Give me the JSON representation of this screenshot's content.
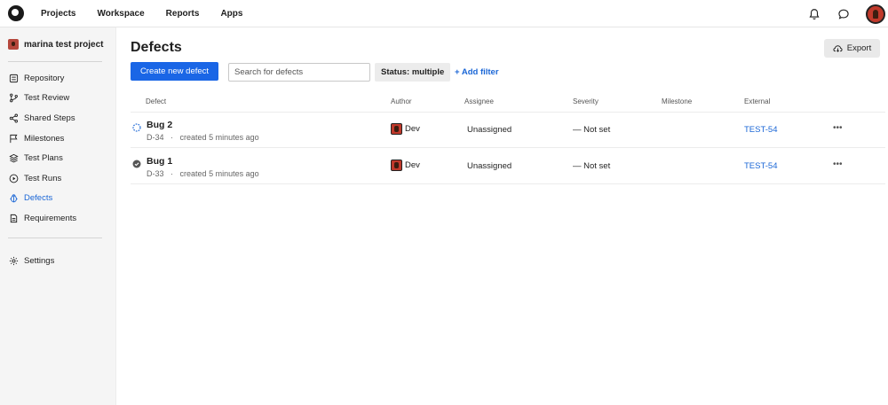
{
  "topnav": {
    "items": [
      "Projects",
      "Workspace",
      "Reports",
      "Apps"
    ]
  },
  "sidebar": {
    "project_name": "marina test project",
    "items": [
      {
        "label": "Repository",
        "icon": "list-icon"
      },
      {
        "label": "Test Review",
        "icon": "branch-icon"
      },
      {
        "label": "Shared Steps",
        "icon": "share-icon"
      },
      {
        "label": "Milestones",
        "icon": "flag-icon"
      },
      {
        "label": "Test Plans",
        "icon": "layers-icon"
      },
      {
        "label": "Test Runs",
        "icon": "play-icon"
      },
      {
        "label": "Defects",
        "icon": "bug-icon",
        "active": true
      },
      {
        "label": "Requirements",
        "icon": "document-icon"
      }
    ],
    "settings_label": "Settings"
  },
  "main": {
    "title": "Defects",
    "export_label": "Export",
    "create_label": "Create new defect",
    "search_placeholder": "Search for defects",
    "status_filter": "Status: multiple",
    "add_filter": "+ Add filter",
    "columns": [
      "Defect",
      "Author",
      "Assignee",
      "Severity",
      "Milestone",
      "External"
    ],
    "rows": [
      {
        "title": "Bug 2",
        "id": "D-34",
        "created": "created 5 minutes ago",
        "status": "in-progress",
        "author": "Dev",
        "assignee": "Unassigned",
        "severity": "— Not set",
        "milestone": "",
        "external": "TEST-54"
      },
      {
        "title": "Bug 1",
        "id": "D-33",
        "created": "created 5 minutes ago",
        "status": "resolved",
        "author": "Dev",
        "assignee": "Unassigned",
        "severity": "— Not set",
        "milestone": "",
        "external": "TEST-54"
      }
    ],
    "meta_separator": "·"
  },
  "colors": {
    "accent": "#1a66e6",
    "link": "#1a66d6"
  }
}
